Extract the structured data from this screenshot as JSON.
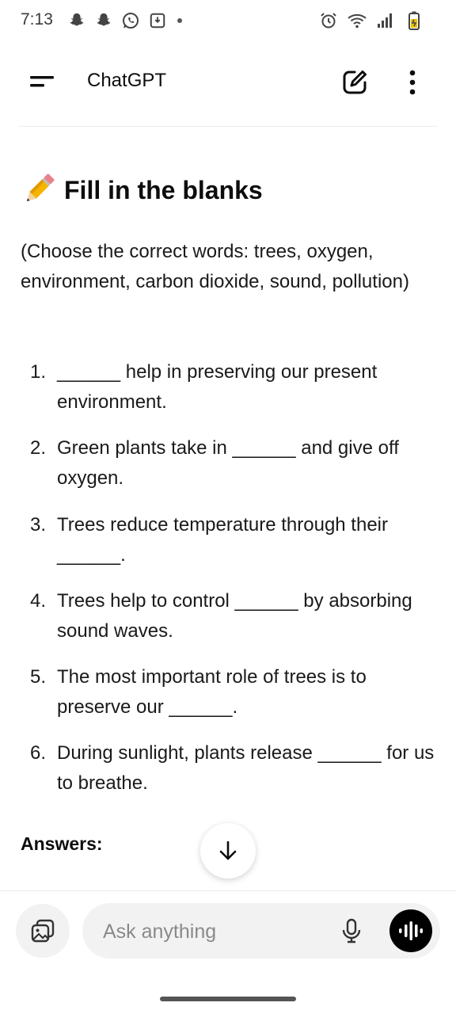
{
  "status_bar": {
    "time": "7:13",
    "left_icons": [
      "snapchat-icon",
      "snapchat-icon",
      "whatsapp-icon",
      "download-box-icon"
    ],
    "right_icons": [
      "alarm-icon",
      "wifi-icon",
      "signal-icon",
      "battery-icon"
    ]
  },
  "header": {
    "title": "ChatGPT"
  },
  "content": {
    "heading_icon": "pencil-emoji",
    "heading": "Fill in the blanks",
    "intro": "(Choose the correct words: trees, oxygen, environment, carbon dioxide, sound, pollution)",
    "questions": [
      {
        "num": "1.",
        "text": "______ help in preserving our present environment."
      },
      {
        "num": "2.",
        "text": "Green plants take in ______ and give off oxygen."
      },
      {
        "num": "3.",
        "text": "Trees reduce temperature through their ______."
      },
      {
        "num": "4.",
        "text": "Trees help to control ______ by absorbing sound waves."
      },
      {
        "num": "5.",
        "text": "The most important role of trees is to preserve our ______."
      },
      {
        "num": "6.",
        "text": "During sunlight, plants release ______ for us to breathe."
      }
    ],
    "answers_label": "Answers:"
  },
  "composer": {
    "placeholder": "Ask anything"
  },
  "colors": {
    "background": "#ffffff",
    "text": "#0d0d0d",
    "composer_bg": "#f2f2f2",
    "voice_button": "#000000"
  }
}
